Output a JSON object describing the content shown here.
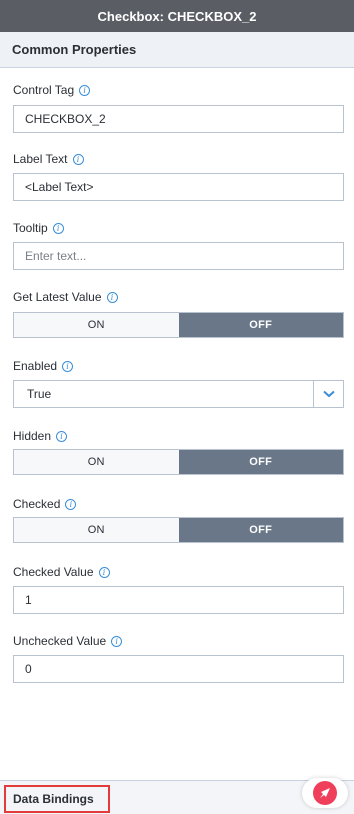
{
  "header": {
    "title": "Checkbox: CHECKBOX_2"
  },
  "section": {
    "title": "Common Properties"
  },
  "fields": {
    "control_tag": {
      "label": "Control Tag",
      "value": "CHECKBOX_2"
    },
    "label_text": {
      "label": "Label Text",
      "value": "<Label Text>"
    },
    "tooltip": {
      "label": "Tooltip",
      "placeholder": "Enter text..."
    },
    "get_latest_value": {
      "label": "Get Latest Value",
      "on": "ON",
      "off": "OFF",
      "selected": "OFF"
    },
    "enabled": {
      "label": "Enabled",
      "value": "True"
    },
    "hidden": {
      "label": "Hidden",
      "on": "ON",
      "off": "OFF",
      "selected": "OFF"
    },
    "checked": {
      "label": "Checked",
      "on": "ON",
      "off": "OFF",
      "selected": "OFF"
    },
    "checked_value": {
      "label": "Checked Value",
      "value": "1"
    },
    "unchecked_value": {
      "label": "Unchecked Value",
      "value": "0"
    }
  },
  "footer": {
    "data_bindings": "Data Bindings"
  },
  "icons": {
    "info": "info-icon",
    "chevron": "chevron-down-icon",
    "fab": "rocket-icon"
  },
  "colors": {
    "accent": "#3a8ed8",
    "toggle_off": "#697789",
    "highlight": "#e23b3b",
    "fab": "#ef3f5a"
  }
}
